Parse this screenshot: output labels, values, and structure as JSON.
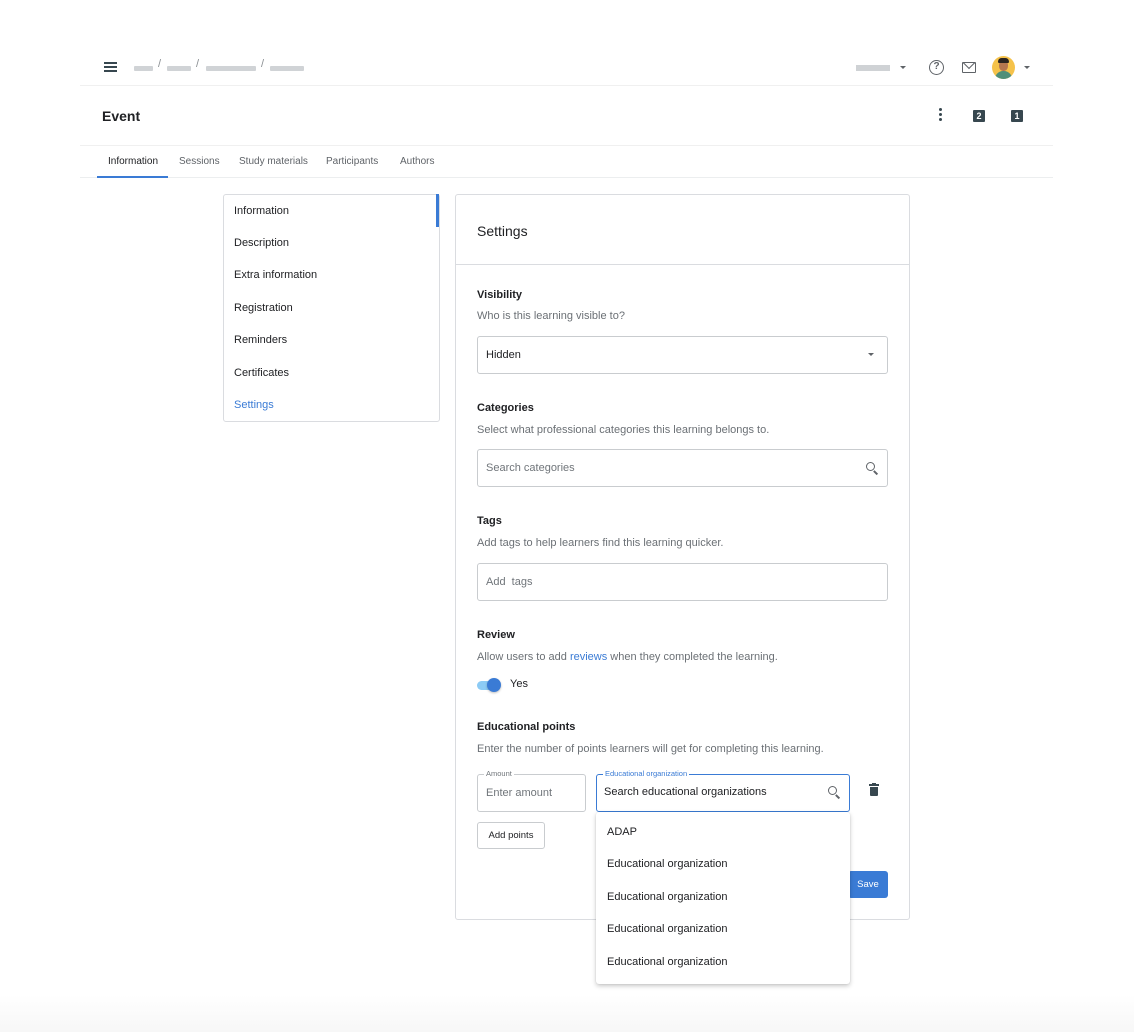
{
  "topbar": {
    "breadcrumb_separators": [
      "/",
      "/",
      "/"
    ],
    "icons": {
      "menu": "hamburger-menu-icon",
      "help": "help-circle-icon",
      "mail": "mail-icon",
      "avatar": "user-avatar",
      "help_glyph": "?"
    }
  },
  "header": {
    "title": "Event",
    "badges": [
      "2",
      "1"
    ]
  },
  "tabs": [
    {
      "label": "Information",
      "active": true
    },
    {
      "label": "Sessions",
      "active": false
    },
    {
      "label": "Study materials",
      "active": false
    },
    {
      "label": "Participants",
      "active": false
    },
    {
      "label": "Authors",
      "active": false
    }
  ],
  "sidenav": {
    "items": [
      {
        "label": "Information",
        "active": false
      },
      {
        "label": "Description",
        "active": false
      },
      {
        "label": "Extra information",
        "active": false
      },
      {
        "label": "Registration",
        "active": false
      },
      {
        "label": "Reminders",
        "active": false
      },
      {
        "label": "Certificates",
        "active": false
      },
      {
        "label": "Settings",
        "active": true
      }
    ]
  },
  "settings": {
    "title": "Settings",
    "visibility": {
      "label": "Visibility",
      "description": "Who is this learning visible to?",
      "selected": "Hidden"
    },
    "categories": {
      "label": "Categories",
      "description": "Select what professional categories this learning belongs to.",
      "placeholder": "Search categories"
    },
    "tags": {
      "label": "Tags",
      "description": "Add tags to help learners find this learning quicker.",
      "placeholder": "Add  tags"
    },
    "review": {
      "label": "Review",
      "description_before": "Allow users to add ",
      "description_link": "reviews",
      "description_after": " when they completed the learning.",
      "toggle_on": true,
      "toggle_label": "Yes"
    },
    "educational_points": {
      "label": "Educational points",
      "description": "Enter the number of points learners will get for completing this learning.",
      "amount_legend": "Amount",
      "amount_placeholder": "Enter amount",
      "org_legend": "Educational organization",
      "org_value": "Search educational organizations",
      "add_points_label": "Add points"
    },
    "save_label": "Save"
  },
  "org_dropdown": {
    "options": [
      "ADAP",
      "Educational organization",
      "Educational organization",
      "Educational organization",
      "Educational organization"
    ]
  },
  "colors": {
    "accent": "#3a7bd5",
    "toggle_track": "#8ccbf5",
    "icon_dark": "#37474f"
  }
}
